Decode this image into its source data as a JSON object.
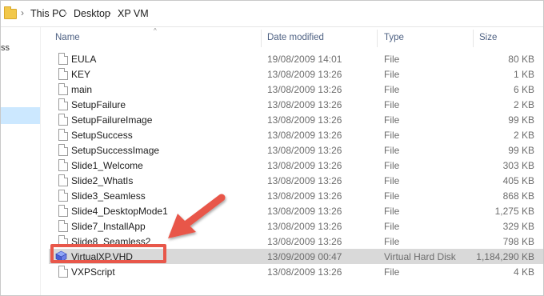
{
  "breadcrumb": {
    "items": [
      "This PC",
      "Desktop",
      "XP VM"
    ]
  },
  "nav": {
    "partial_text": "ss"
  },
  "columns": {
    "name": "Name",
    "date": "Date modified",
    "type": "Type",
    "size": "Size"
  },
  "files": [
    {
      "name": "EULA",
      "date": "19/08/2009 14:01",
      "type": "File",
      "size": "80 KB"
    },
    {
      "name": "KEY",
      "date": "13/08/2009 13:26",
      "type": "File",
      "size": "1 KB"
    },
    {
      "name": "main",
      "date": "13/08/2009 13:26",
      "type": "File",
      "size": "6 KB"
    },
    {
      "name": "SetupFailure",
      "date": "13/08/2009 13:26",
      "type": "File",
      "size": "2 KB"
    },
    {
      "name": "SetupFailureImage",
      "date": "13/08/2009 13:26",
      "type": "File",
      "size": "99 KB"
    },
    {
      "name": "SetupSuccess",
      "date": "13/08/2009 13:26",
      "type": "File",
      "size": "2 KB"
    },
    {
      "name": "SetupSuccessImage",
      "date": "13/08/2009 13:26",
      "type": "File",
      "size": "99 KB"
    },
    {
      "name": "Slide1_Welcome",
      "date": "13/08/2009 13:26",
      "type": "File",
      "size": "303 KB"
    },
    {
      "name": "Slide2_WhatIs",
      "date": "13/08/2009 13:26",
      "type": "File",
      "size": "405 KB"
    },
    {
      "name": "Slide3_Seamless",
      "date": "13/08/2009 13:26",
      "type": "File",
      "size": "868 KB"
    },
    {
      "name": "Slide4_DesktopMode1",
      "date": "13/08/2009 13:26",
      "type": "File",
      "size": "1,275 KB"
    },
    {
      "name": "Slide7_InstallApp",
      "date": "13/08/2009 13:26",
      "type": "File",
      "size": "329 KB"
    },
    {
      "name": "Slide8_Seamless2",
      "date": "13/08/2009 13:26",
      "type": "File",
      "size": "798 KB"
    },
    {
      "name": "VirtualXP.VHD",
      "date": "13/09/2009 00:47",
      "type": "Virtual Hard Disk",
      "size": "1,184,290 KB",
      "selected": true,
      "icon": "virtual-disk-icon"
    },
    {
      "name": "VXPScript",
      "date": "13/08/2009 13:26",
      "type": "File",
      "size": "4 KB"
    }
  ],
  "colors": {
    "highlight": "#e8574a",
    "selected_row": "#d9d9d9",
    "nav_selected": "#cce8ff",
    "header_text": "#4d6082"
  }
}
